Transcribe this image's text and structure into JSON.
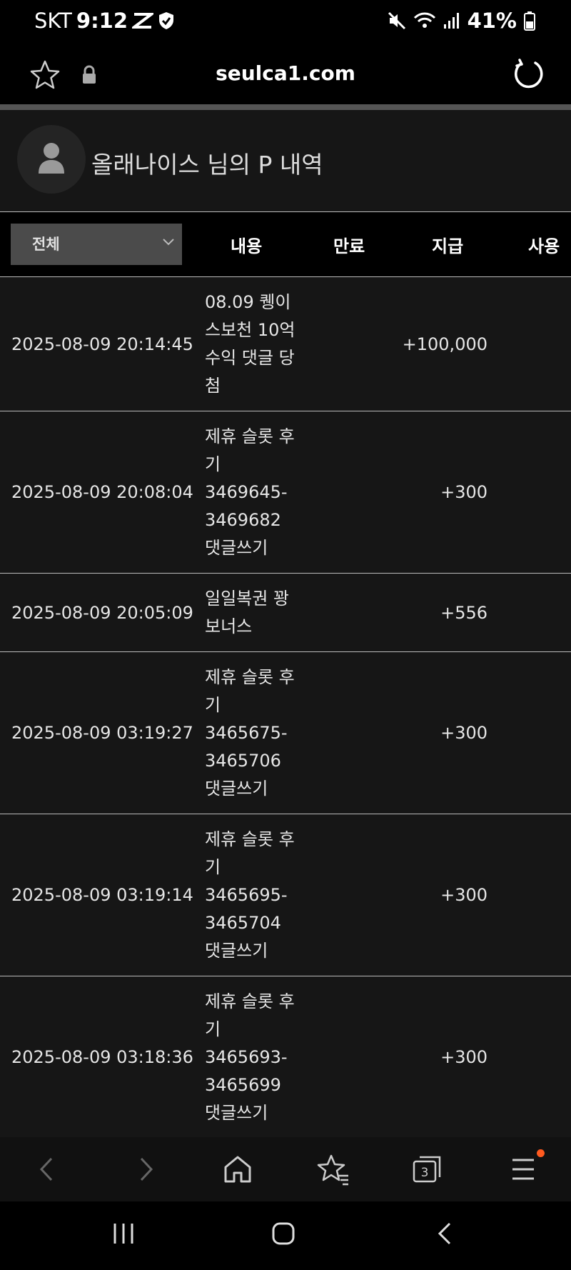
{
  "status_bar": {
    "carrier": "SKT",
    "time": "9:12",
    "battery": "41%"
  },
  "browser": {
    "url": "seulca1.com"
  },
  "profile": {
    "title": "올래나이스 님의 P 내역"
  },
  "table": {
    "filter_value": "전체",
    "headers": {
      "content": "내용",
      "expiry": "만료",
      "paid": "지급",
      "used": "사용"
    },
    "rows": [
      {
        "date": "2025-08-09 20:14:45",
        "content": "08.09 퀭이스보천 10억 수익 댓글 당첨",
        "amount": "+100,000",
        "height": 188
      },
      {
        "date": "2025-08-09 20:08:04",
        "content": "제휴 슬롯 후기 3469645-3469682 댓글쓰기",
        "amount": "+300",
        "height": 227
      },
      {
        "date": "2025-08-09 20:05:09",
        "content": "일일복권 꽝 보너스",
        "amount": "+556",
        "height": 110
      },
      {
        "date": "2025-08-09 03:19:27",
        "content": "제휴 슬롯 후기 3465675-3465706 댓글쓰기",
        "amount": "+300",
        "height": 227
      },
      {
        "date": "2025-08-09 03:19:14",
        "content": "제휴 슬롯 후기 3465695-3465704 댓글쓰기",
        "amount": "+300",
        "height": 227
      },
      {
        "date": "2025-08-09 03:18:36",
        "content": "제휴 슬롯 후기 3465693-3465699 댓글쓰기",
        "amount": "+300",
        "height": 227
      }
    ]
  },
  "icons": {
    "status": [
      "mute-icon",
      "wifi-icon",
      "signal-icon",
      "battery-icon"
    ],
    "browser": [
      "star-icon",
      "lock-icon",
      "reload-icon"
    ],
    "bottom_nav": [
      "back-icon",
      "forward-icon",
      "home-icon",
      "bookmarks-icon",
      "tabs-icon",
      "menu-icon"
    ],
    "tabs_count": "3"
  },
  "colors": {
    "background": "#161616",
    "header_bg": "#000000",
    "filter_bg": "#4b4b4b",
    "notification_dot": "#ff5a1f"
  }
}
